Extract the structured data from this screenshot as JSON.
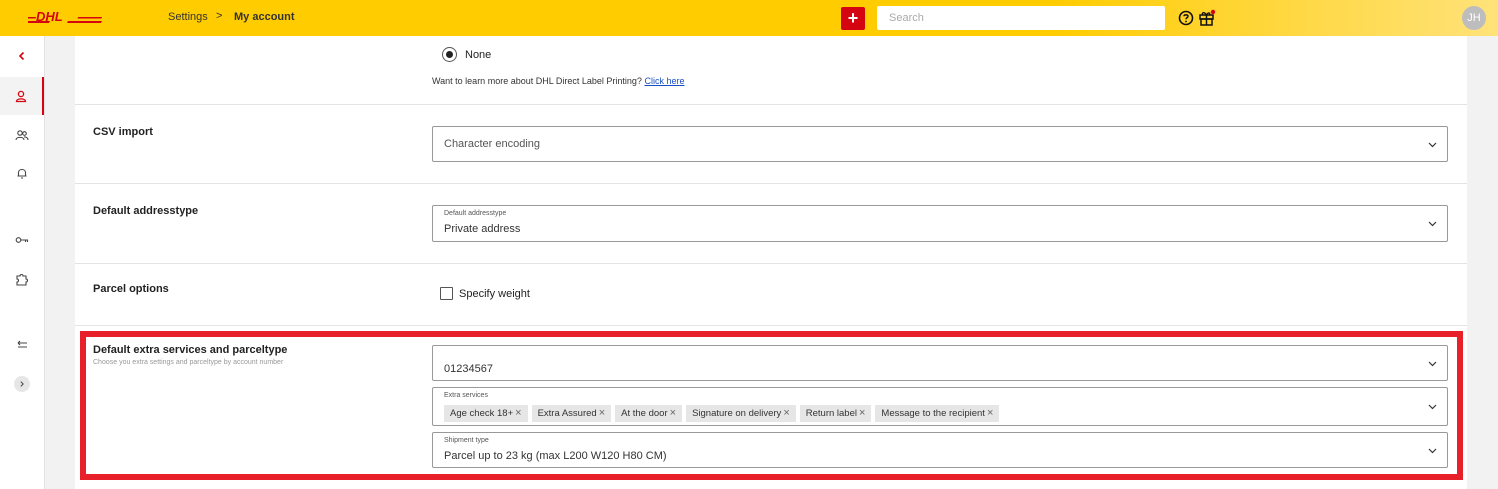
{
  "header": {
    "logo_text": "DHL",
    "breadcrumb": [
      "Settings",
      "My account"
    ],
    "breadcrumb_separator": ">",
    "add_label": "+",
    "search_placeholder": "Search",
    "avatar_initials": "JH",
    "icons": [
      "help-icon",
      "gift-icon"
    ]
  },
  "colors": {
    "brand_yellow": "#ffcc00",
    "brand_red": "#d40511",
    "highlight": "#e8202a"
  },
  "sidebar": {
    "items": [
      {
        "name": "back",
        "icon": "chevron-left-icon"
      },
      {
        "name": "my-account",
        "icon": "person-icon",
        "active": true
      },
      {
        "name": "users",
        "icon": "users-icon"
      },
      {
        "name": "notifications",
        "icon": "bell-icon"
      },
      {
        "name": "keys",
        "icon": "key-icon"
      },
      {
        "name": "integrations",
        "icon": "puzzle-icon"
      },
      {
        "name": "logout",
        "icon": "return-icon"
      }
    ],
    "expand_icon": "chevron-right-icon"
  },
  "label_printing": {
    "radio_label": "None",
    "learn_text": "Want to learn more about DHL Direct Label Printing?",
    "learn_link": "Click here"
  },
  "csv_import": {
    "title": "CSV import",
    "select_placeholder": "Character encoding"
  },
  "default_addresstype": {
    "title": "Default addresstype",
    "field_label": "Default addresstype",
    "value": "Private address"
  },
  "parcel_options": {
    "title": "Parcel options",
    "checkbox_label": "Specify weight"
  },
  "extra_services": {
    "title": "Default extra services and parceltype",
    "subtitle": "Choose you extra settings and parceltype by account number",
    "account_number": "01234567",
    "extra_services_label": "Extra services",
    "chips": [
      "Age check 18+",
      "Extra Assured",
      "At the door",
      "Signature on delivery",
      "Return label",
      "Message to the recipient"
    ],
    "shipment_type_label": "Shipment type",
    "shipment_type_value": "Parcel up to 23 kg (max L200 W120 H80 CM)"
  }
}
